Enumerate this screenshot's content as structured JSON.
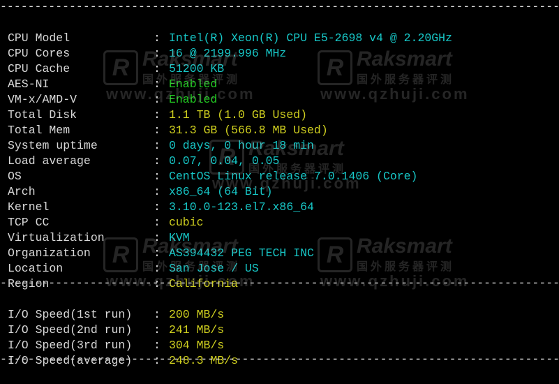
{
  "separator": "--------------------------------------------------------------------------------------------------------------",
  "info_rows": [
    {
      "label": "CPU Model",
      "value": "Intel(R) Xeon(R) CPU E5-2698 v4 @ 2.20GHz",
      "color": "cyan"
    },
    {
      "label": "CPU Cores",
      "value": "16 @ 2199.996 MHz",
      "color": "cyan"
    },
    {
      "label": "CPU Cache",
      "value": "51200 KB",
      "color": "cyan"
    },
    {
      "label": "AES-NI",
      "value": "Enabled",
      "color": "green"
    },
    {
      "label": "VM-x/AMD-V",
      "value": "Enabled",
      "color": "green"
    },
    {
      "label": "Total Disk",
      "value": "1.1 TB (1.0 GB Used)",
      "color": "yellow"
    },
    {
      "label": "Total Mem",
      "value": "31.3 GB (566.8 MB Used)",
      "color": "yellow"
    },
    {
      "label": "System uptime",
      "value": "0 days, 0 hour 18 min",
      "color": "cyan"
    },
    {
      "label": "Load average",
      "value": "0.07, 0.04, 0.05",
      "color": "cyan"
    },
    {
      "label": "OS",
      "value": "CentOS Linux release 7.0.1406 (Core)",
      "color": "cyan"
    },
    {
      "label": "Arch",
      "value": "x86_64 (64 Bit)",
      "color": "cyan"
    },
    {
      "label": "Kernel",
      "value": "3.10.0-123.el7.x86_64",
      "color": "cyan"
    },
    {
      "label": "TCP CC",
      "value": "cubic",
      "color": "yellow"
    },
    {
      "label": "Virtualization",
      "value": "KVM",
      "color": "cyan"
    },
    {
      "label": "Organization",
      "value": "AS394432 PEG TECH INC",
      "color": "cyan"
    },
    {
      "label": "Location",
      "value": "San Jose / US",
      "color": "cyan"
    },
    {
      "label": "Region",
      "value": "California",
      "color": "yellow"
    }
  ],
  "io_rows": [
    {
      "label": "I/O Speed(1st run)",
      "value": "200 MB/s",
      "color": "yellow"
    },
    {
      "label": "I/O Speed(2nd run)",
      "value": "241 MB/s",
      "color": "yellow"
    },
    {
      "label": "I/O Speed(3rd run)",
      "value": "304 MB/s",
      "color": "yellow"
    },
    {
      "label": "I/O Speed(average)",
      "value": "248.3 MB/s",
      "color": "yellow"
    }
  ],
  "watermark": {
    "logo_letter": "R",
    "brand": "Raksmart",
    "subtitle": "国外服务器评测",
    "url": "www.qzhuji.com"
  },
  "colors": {
    "background": "#000000",
    "label": "#d8d8d8",
    "cyan": "#17c7c7",
    "green": "#22cc22",
    "yellow": "#cfcf1f"
  }
}
